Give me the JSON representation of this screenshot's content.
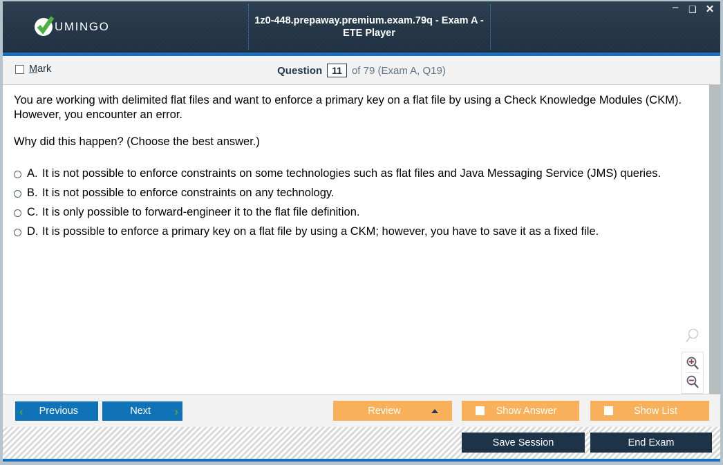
{
  "window": {
    "title": "1z0-448.prepaway.premium.exam.79q - Exam A - ETE Player",
    "minimize_label": "–",
    "maximize_label": "❑",
    "close_label": "✕",
    "accent_color": "#1a6fbd",
    "titlebar_color": "#243747"
  },
  "brand": {
    "name": "UMINGO",
    "check_color": "#4caf3f"
  },
  "question_bar": {
    "mark_label_prefix": "",
    "mark_label_accel": "M",
    "mark_label_rest": "ark",
    "mark_checked": false,
    "question_word": "Question",
    "question_number": "11",
    "rest": "of 79 (Exam A, Q19)"
  },
  "question": {
    "paragraphs": [
      "You are working with delimited flat files and want to enforce a primary key on a flat file by using a Check Knowledge Modules (CKM). However, you encounter an error.",
      "Why did this happen? (Choose the best answer.)"
    ],
    "options": [
      {
        "letter": "A.",
        "text": "It is not possible to enforce constraints on some technologies such as flat files and Java Messaging Service (JMS) queries.",
        "selected": false
      },
      {
        "letter": "B.",
        "text": "It is not possible to enforce constraints on any technology.",
        "selected": false
      },
      {
        "letter": "C.",
        "text": "It is only possible to forward-engineer it to the flat file definition.",
        "selected": false
      },
      {
        "letter": "D.",
        "text": "It is possible to enforce a primary key on a flat file by using a CKM; however, you have to save it as a fixed file.",
        "selected": false
      }
    ]
  },
  "zoom_tools": {
    "ghost_label": "magnifier-icon",
    "zoom_in_label": "zoom-in-icon",
    "zoom_out_label": "zoom-out-icon"
  },
  "toolbar": {
    "previous_label": "Previous",
    "next_label": "Next",
    "previous_chevron": "‹",
    "next_chevron": "›",
    "review_label": "Review",
    "show_answer_label": "Show Answer",
    "show_list_label": "Show List",
    "show_answer_checked": false,
    "show_list_checked": false,
    "button_color_nav": "#1073b8",
    "button_color_orange": "#f8b05a"
  },
  "statusbar": {
    "save_session_label": "Save Session",
    "end_exam_label": "End Exam",
    "button_color": "#1d3348"
  }
}
